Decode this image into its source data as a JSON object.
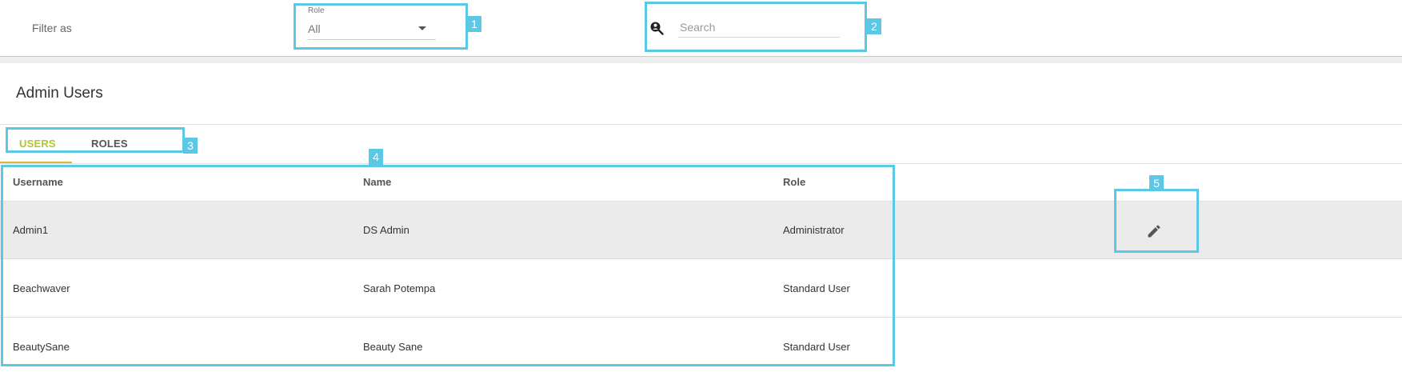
{
  "filter": {
    "label": "Filter as",
    "role_caption": "Role",
    "role_value": "All",
    "search_placeholder": "Search",
    "search_value": ""
  },
  "page": {
    "title": "Admin Users"
  },
  "tabs": [
    {
      "label": "USERS",
      "active": true
    },
    {
      "label": "ROLES",
      "active": false
    }
  ],
  "table": {
    "columns": [
      "Username",
      "Name",
      "Role"
    ],
    "rows": [
      {
        "username": "Admin1",
        "name": "DS Admin",
        "role": "Administrator",
        "selected": true
      },
      {
        "username": "Beachwaver",
        "name": "Sarah Potempa",
        "role": "Standard User",
        "selected": false
      },
      {
        "username": "BeautySane",
        "name": "Beauty Sane",
        "role": "Standard User",
        "selected": false
      }
    ]
  },
  "annotations": [
    "1",
    "2",
    "3",
    "4",
    "5"
  ],
  "icons": {
    "search": "search-user-icon",
    "edit": "pencil-icon",
    "dropdown": "caret-down-icon"
  },
  "colors": {
    "annotation": "#5bc8e6",
    "active_tab": "#b5c42c",
    "tab_indicator": "#d9b53a",
    "selected_row": "#ebebeb"
  }
}
